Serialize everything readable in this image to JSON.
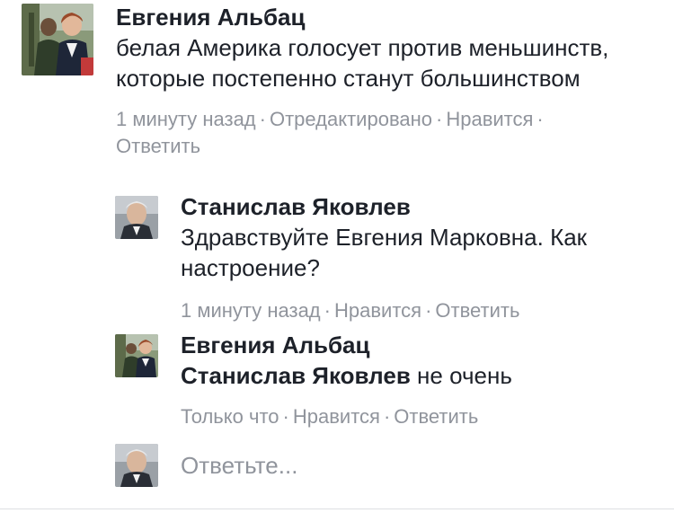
{
  "comments": [
    {
      "author": "Евгения Альбац",
      "text": "белая Америка голосует против меньшинств, которые постепенно станут большинством",
      "time": "1 минуту назад",
      "edited": "Отредактировано",
      "like": "Нравится",
      "reply": "Ответить"
    }
  ],
  "replies": [
    {
      "author": "Станислав Яковлев",
      "text": "Здравствуйте Евгения Марковна. Как настроение?",
      "time": "1 минуту назад",
      "like": "Нравится",
      "reply": "Ответить"
    },
    {
      "author": "Евгения Альбац",
      "mention": "Станислав Яковлев",
      "text": " не очень",
      "time": "Только что",
      "like": "Нравится",
      "reply": "Ответить"
    }
  ],
  "composer": {
    "placeholder": "Ответьте..."
  },
  "colors": {
    "text": "#1d2129",
    "meta": "#90949c"
  }
}
